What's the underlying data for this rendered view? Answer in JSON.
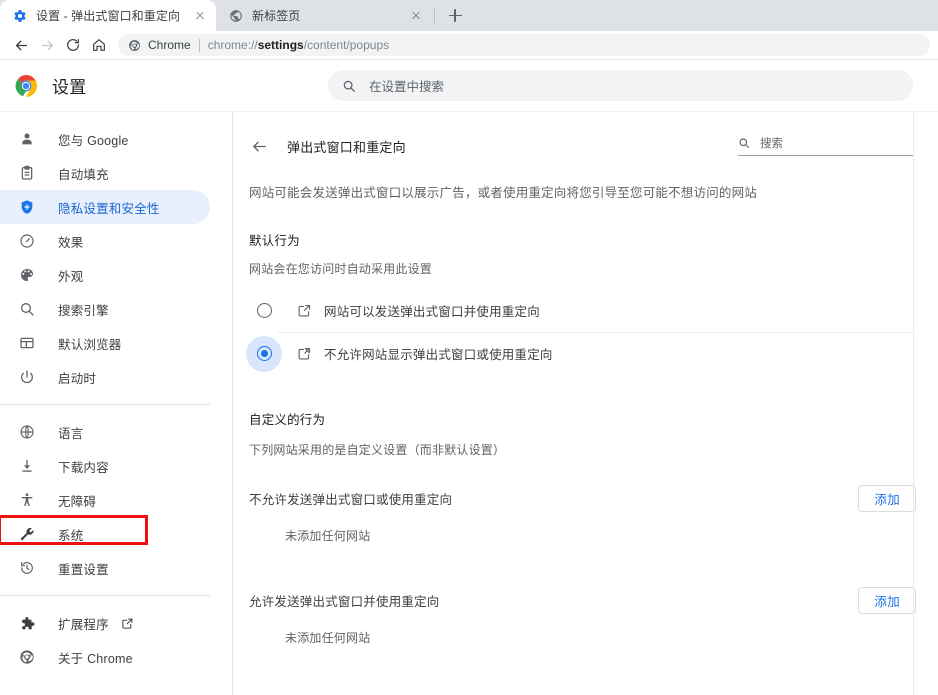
{
  "window": {
    "tabs": [
      {
        "title": "设置 - 弹出式窗口和重定向",
        "favicon": "gear-icon",
        "active": true
      },
      {
        "title": "新标签页",
        "favicon": "globe-icon",
        "active": false
      }
    ],
    "new_tab_label": "+",
    "omnibox": {
      "scheme_label": "Chrome",
      "url_prefix": "chrome://",
      "url_bold": "settings",
      "url_suffix": "/content/popups",
      "icon": "chrome-shield-icon"
    },
    "nav": {
      "back": "←",
      "forward": "→",
      "reload": "C",
      "home": "⌂"
    }
  },
  "settings_header": {
    "logo": "chrome-logo",
    "title": "设置",
    "search_placeholder": "在设置中搜索",
    "search_icon": "search-icon"
  },
  "sidebar": {
    "groups": [
      {
        "items": [
          {
            "label": "您与 Google",
            "icon": "person-icon",
            "selected": false
          },
          {
            "label": "自动填充",
            "icon": "clipboard-icon",
            "selected": false
          },
          {
            "label": "隐私设置和安全性",
            "icon": "shield-icon",
            "selected": true
          },
          {
            "label": "效果",
            "icon": "speedometer-icon",
            "selected": false
          },
          {
            "label": "外观",
            "icon": "palette-icon",
            "selected": false
          },
          {
            "label": "搜索引擎",
            "icon": "search-icon",
            "selected": false
          },
          {
            "label": "默认浏览器",
            "icon": "browser-window-icon",
            "selected": false
          },
          {
            "label": "启动时",
            "icon": "power-icon",
            "selected": false
          }
        ]
      },
      {
        "items": [
          {
            "label": "语言",
            "icon": "globe-icon",
            "selected": false
          },
          {
            "label": "下载内容",
            "icon": "download-icon",
            "selected": false
          },
          {
            "label": "无障碍",
            "icon": "accessibility-icon",
            "selected": false
          },
          {
            "label": "系统",
            "icon": "wrench-icon",
            "selected": false,
            "highlighted": true
          },
          {
            "label": "重置设置",
            "icon": "history-restore-icon",
            "selected": false
          }
        ]
      },
      {
        "items": [
          {
            "label": "扩展程序",
            "icon": "puzzle-icon",
            "selected": false,
            "external": true,
            "external_icon": "open-in-new-icon"
          },
          {
            "label": "关于 Chrome",
            "icon": "chrome-icon",
            "selected": false
          }
        ]
      }
    ],
    "highlight_color": "#ee1111"
  },
  "content": {
    "back_icon": "back-arrow-icon",
    "title": "弹出式窗口和重定向",
    "search_placeholder": "搜索",
    "search_icon": "search-icon",
    "description": "网站可能会发送弹出式窗口以展示广告，或者使用重定向将您引导至您可能不想访问的网站",
    "default_behavior_label": "默认行为",
    "default_behavior_sub": "网站会在您访问时自动采用此设置",
    "radio_options": [
      {
        "label": "网站可以发送弹出式窗口并使用重定向",
        "icon": "open-in-new-icon",
        "checked": false
      },
      {
        "label": "不允许网站显示弹出式窗口或使用重定向",
        "icon": "open-in-new-blocked-icon",
        "checked": true
      }
    ],
    "custom_behavior_label": "自定义的行为",
    "custom_behavior_sub": "下列网站采用的是自定义设置（而非默认设置）",
    "lists": [
      {
        "label": "不允许发送弹出式窗口或使用重定向",
        "add_button": "添加",
        "empty": "未添加任何网站"
      },
      {
        "label": "允许发送弹出式窗口并使用重定向",
        "add_button": "添加",
        "empty": "未添加任何网站"
      }
    ]
  },
  "colors": {
    "accent": "#1a73e8",
    "selected_bg": "#e8f0fe",
    "tabstrip_bg": "#dee1e6",
    "text_primary": "#202124",
    "text_secondary": "#5f6368"
  }
}
